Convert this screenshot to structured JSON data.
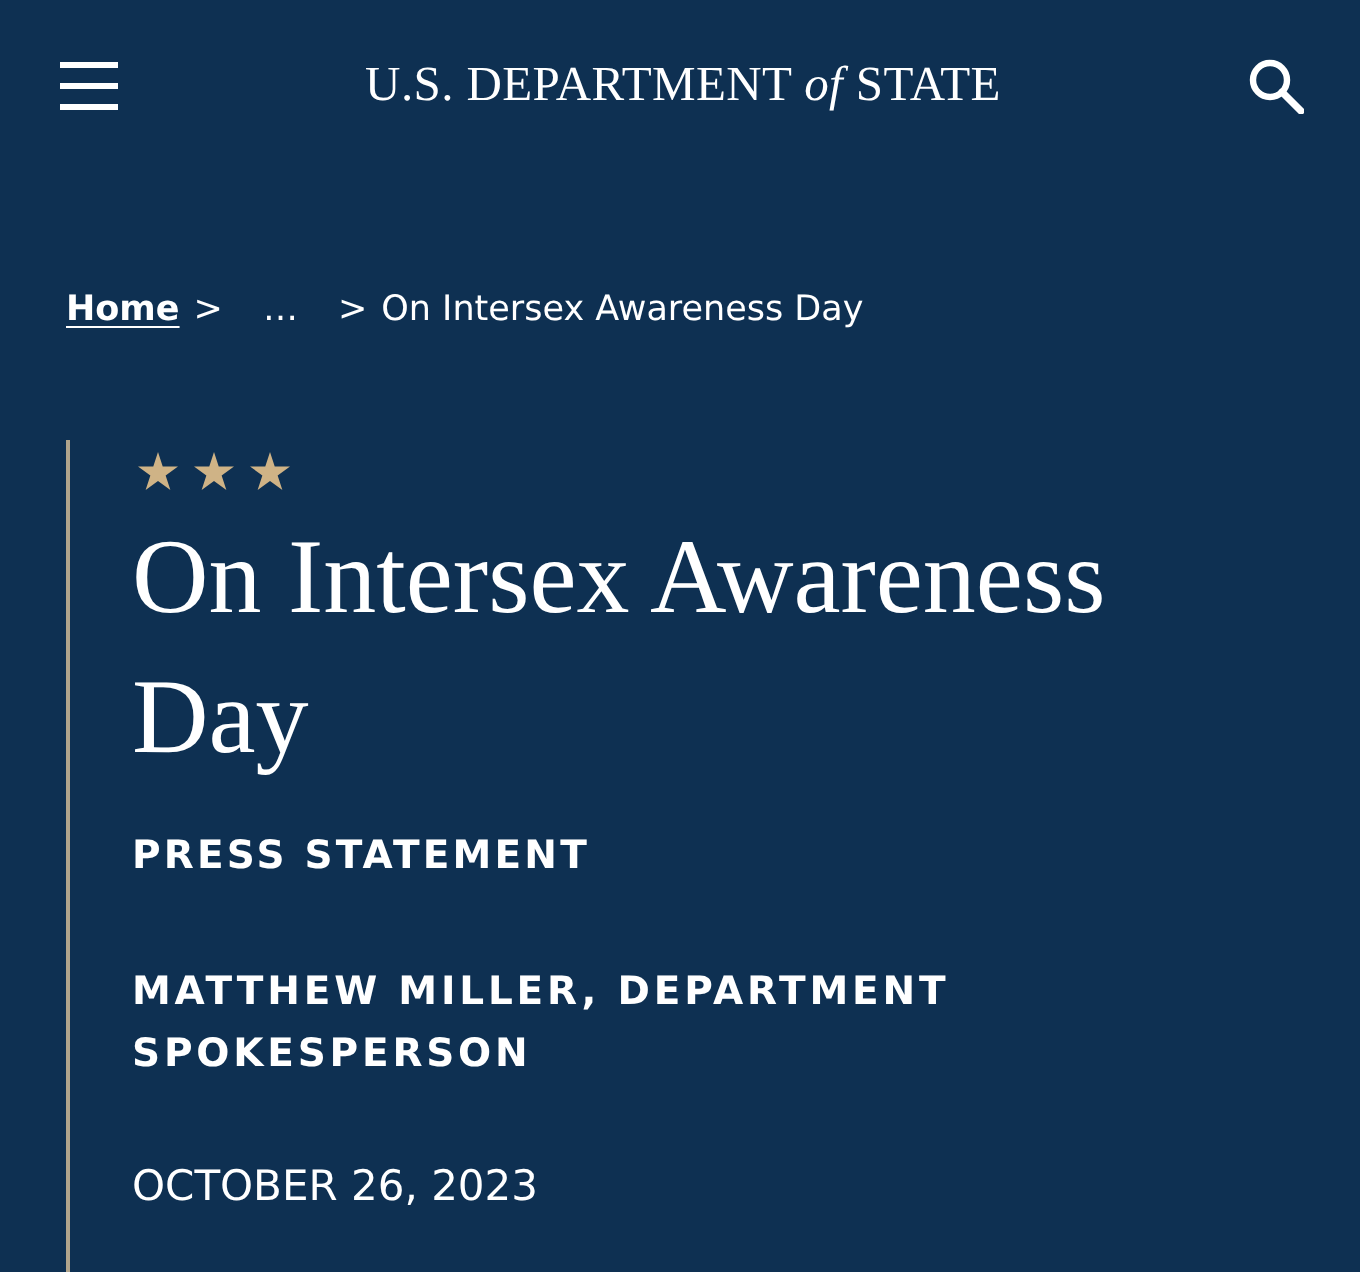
{
  "header": {
    "logo": "U.S. DEPARTMENT *of* STATE"
  },
  "breadcrumb": {
    "separator": ">",
    "items": [
      {
        "label": "Home",
        "kind": "link"
      },
      {
        "label": "…",
        "kind": "ellipsis"
      },
      {
        "label": "On Intersex Awareness Day",
        "kind": "current"
      }
    ]
  },
  "article": {
    "title": "On Intersex Awareness Day",
    "type": "PRESS STATEMENT",
    "author": "MATTHEW MILLER, DEPARTMENT SPOKESPERSON",
    "date": "OCTOBER 26, 2023"
  }
}
